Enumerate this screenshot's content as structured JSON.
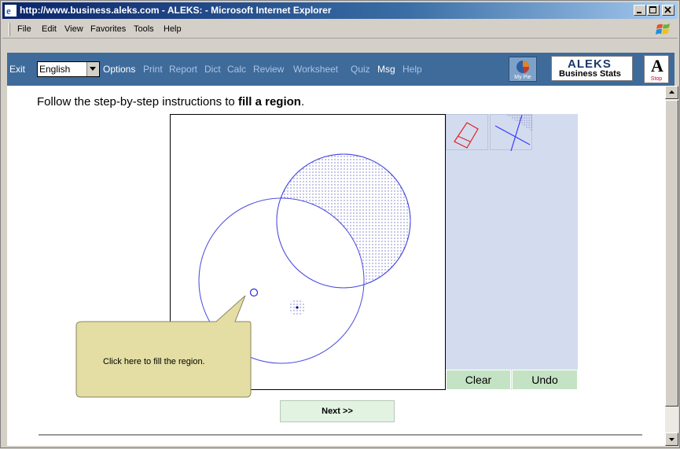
{
  "window": {
    "title": "http://www.business.aleks.com - ALEKS: - Microsoft Internet Explorer"
  },
  "menu": {
    "items": [
      "File",
      "Edit",
      "View",
      "Favorites",
      "Tools",
      "Help"
    ]
  },
  "toolbar": {
    "exit_label": "Exit",
    "language_selected": "English",
    "nav": [
      {
        "label": "Options",
        "active": true
      },
      {
        "label": "Print",
        "active": false
      },
      {
        "label": "Report",
        "active": false
      },
      {
        "label": "Dict",
        "active": false
      },
      {
        "label": "Calc",
        "active": false
      },
      {
        "label": "Review",
        "active": false
      },
      {
        "label": "Worksheet",
        "active": false
      },
      {
        "label": "Quiz",
        "active": false
      },
      {
        "label": "Msg",
        "active": true
      },
      {
        "label": "Help",
        "active": false
      }
    ],
    "mypie_label": "My Pie",
    "logo_main": "ALEKS",
    "logo_sub": "Business Stats",
    "stop_letter": "A",
    "stop_label": "Stop"
  },
  "content": {
    "instruction_prefix": "Follow the step-by-step instructions to ",
    "instruction_bold": "fill a region",
    "instruction_suffix": ".",
    "callout_text": "Click here to fill the region.",
    "clear_label": "Clear",
    "undo_label": "Undo",
    "next_label": "Next >>"
  },
  "icons": [
    "ie-icon",
    "minimize-icon",
    "maximize-icon",
    "close-icon",
    "windows-logo-icon",
    "eraser-icon",
    "fill-tool-icon",
    "mypie-icon",
    "scroll-up-icon",
    "scroll-down-icon"
  ],
  "colors": {
    "toolbar_bg": "#3f6b9b",
    "circle_stroke": "#4a4adf",
    "panel_bg": "#d3dcee",
    "button_green": "#c4e3c4",
    "callout_bg": "#e4dea4"
  }
}
